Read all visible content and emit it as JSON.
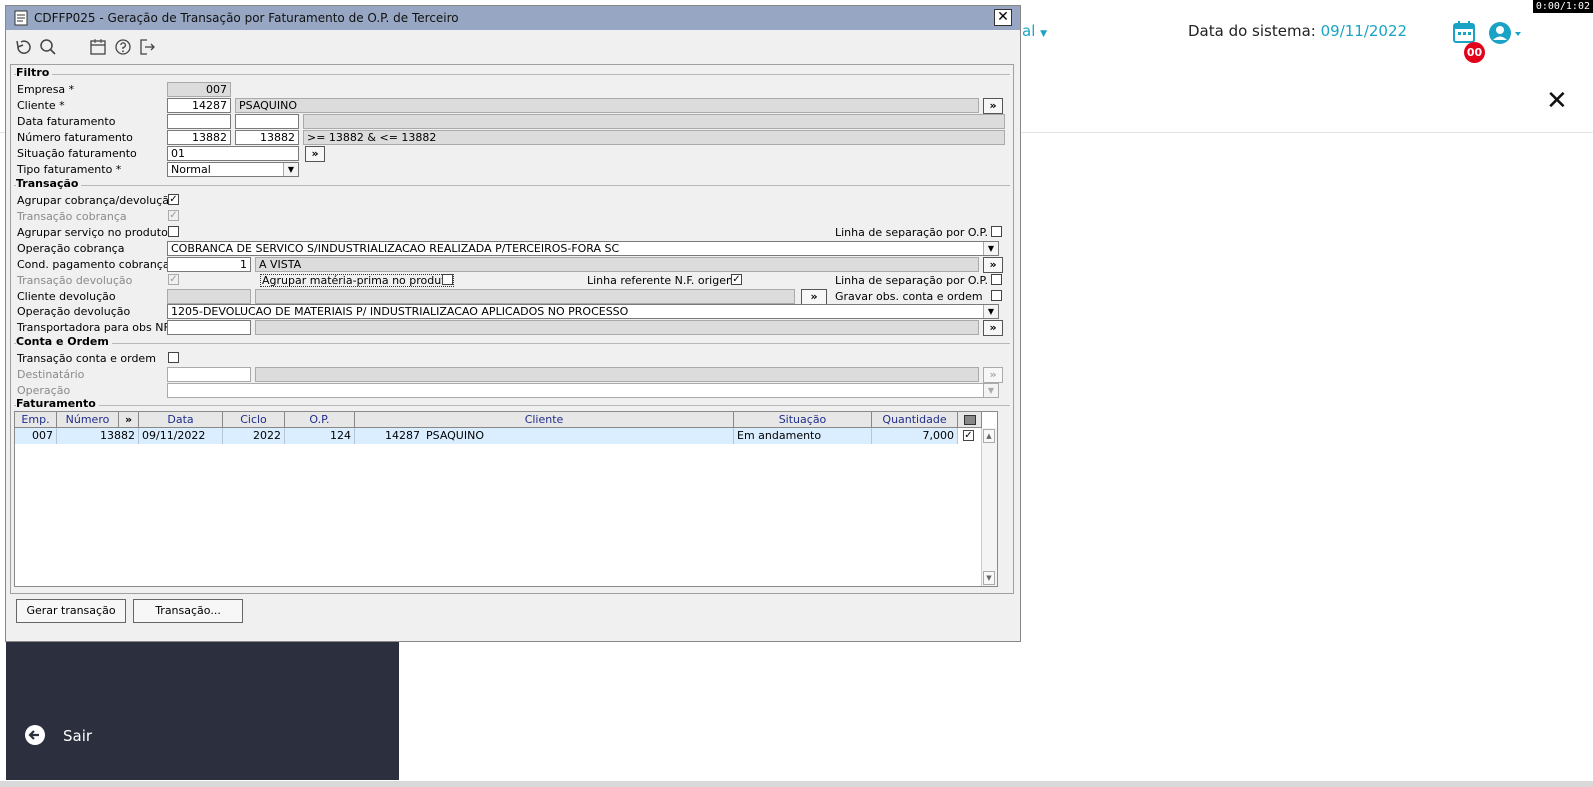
{
  "timer": "0:00/1:02",
  "background": {
    "nav_partial": "al",
    "date_label": "Data do sistema:",
    "date_value": "09/11/2022",
    "badge": "00",
    "sidebar_exit": "Sair"
  },
  "window": {
    "title": "CDFFP025 - Geração de Transação por Faturamento de O.P. de Terceiro",
    "close_glyph": "✕"
  },
  "filtro": {
    "section": "Filtro",
    "empresa_label": "Empresa *",
    "empresa_value": "007",
    "cliente_label": "Cliente *",
    "cliente_code": "14287",
    "cliente_name": "PSAQUINO",
    "data_label": "Data faturamento",
    "data_from": "",
    "data_to": "",
    "numero_label": "Número faturamento",
    "numero_from": "13882",
    "numero_to": "13882",
    "numero_expr": " >= 13882 & <= 13882",
    "situacao_label": "Situação faturamento",
    "situacao_value": "01",
    "tipo_label": "Tipo faturamento *",
    "tipo_value": "Normal"
  },
  "transacao": {
    "section": "Transação",
    "agrupar_cobranca_label": "Agrupar cobrança/devolução",
    "transacao_cobranca_label": "Transação cobrança",
    "agrupar_servico_label": "Agrupar serviço no produto",
    "linha_sep_label": "Linha de separação por O.P.",
    "operacao_cobranca_label": "Operação cobrança",
    "operacao_cobranca_value": "COBRANCA DE SERVICO S/INDUSTRIALIZACAO REALIZADA P/TERCEIROS-FORA SC",
    "cond_pag_label": "Cond. pagamento cobrança *",
    "cond_pag_code": "1",
    "cond_pag_name": "A VISTA",
    "transacao_devolucao_label": "Transação devolução",
    "agrupar_materia_label": "Agrupar matéria-prima no produto",
    "linha_ref_label": "Linha referente N.F. origem",
    "linha_sep2_label": "Linha de separação por O.P.",
    "cliente_dev_label": "Cliente devolução",
    "gravar_obs_label": "Gravar obs. conta e ordem",
    "operacao_devolucao_label": "Operação devolução",
    "operacao_devolucao_value": "1205-DEVOLUCAO DE MATERIAIS P/ INDUSTRIALIZACAO APLICADOS NO PROCESSO",
    "transportadora_label": "Transportadora para obs NF"
  },
  "conta_ordem": {
    "section": "Conta e Ordem",
    "transacao_label": "Transação conta e ordem",
    "destinatario_label": "Destinatário",
    "operacao_label": "Operação"
  },
  "faturamento": {
    "section": "Faturamento",
    "columns": [
      "Emp.",
      "Número",
      "»",
      "Data",
      "Ciclo",
      "O.P.",
      "Cliente",
      "Situação",
      "Quantidade"
    ],
    "rows": [
      {
        "emp": "007",
        "numero": "13882",
        "data": "09/11/2022",
        "ciclo": "2022",
        "op": "124",
        "cliente_code": "14287",
        "cliente_name": "PSAQUINO",
        "situacao": "Em andamento",
        "quantidade": "7,000",
        "checked": "✓"
      }
    ]
  },
  "buttons": {
    "gerar": "Gerar transação",
    "transacao": "Transação...",
    "arrow": "»",
    "check": "✓",
    "dropdown": "▼"
  }
}
